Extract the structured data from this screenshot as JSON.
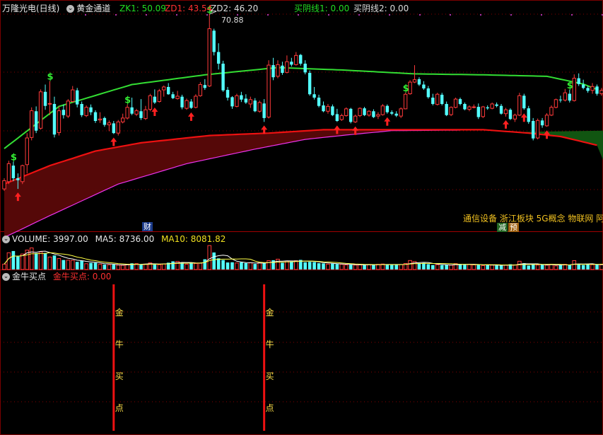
{
  "main": {
    "title": "万隆光电(日线)",
    "indicator_name": "黄金通道",
    "legend": [
      {
        "key": "zk1",
        "text": "ZK1: 50.09",
        "color": "#22dd22"
      },
      {
        "key": "zd1",
        "text": "ZD1: 43.54",
        "color": "#ff3030"
      },
      {
        "key": "zd2",
        "text": "ZD2: 46.20",
        "color": "#dddddd"
      },
      {
        "key": "syx1",
        "text": "买阴线1: 0.00",
        "color": "#22dd22"
      },
      {
        "key": "syx2",
        "text": "买阴线2: 0.00",
        "color": "#dddddd"
      }
    ],
    "high_label": "70.88",
    "finance_badge": "财",
    "concepts": "通信设备 浙江板块 5G概念 物联网 阿",
    "badge_reduce": "减",
    "badge_pre": "预",
    "dollar_marker": "$"
  },
  "volume": {
    "label": "VOLUME: 3997.00",
    "ma5": "MA5: 8736.00",
    "ma10": "MA10: 8081.82"
  },
  "signal": {
    "name": "金牛买点",
    "value_text": "金牛买点: 0.00",
    "vertical_chars": [
      "金",
      "牛",
      "买",
      "点"
    ]
  },
  "colors": {
    "up": "#ff3a3a",
    "down": "#54ffff",
    "upper_line": "#33dd33",
    "lower_line": "#ee1111",
    "pink_line": "#ee33ee",
    "channel_fill": "#5a0808",
    "channel_fill_green": "#115511",
    "grid_dot": "#880000",
    "ma5": "#ffffff",
    "ma10": "#ffff44"
  },
  "chart_data": {
    "type": "candlestick",
    "price_range": [
      28,
      72
    ],
    "candles": [
      [
        36,
        38.2,
        35.6,
        37.7
      ],
      [
        37.5,
        41.8,
        37,
        41.2
      ],
      [
        40.8,
        41.6,
        37.6,
        38.2
      ],
      [
        38.2,
        39.2,
        36,
        37.8
      ],
      [
        37.5,
        41,
        37,
        40.8
      ],
      [
        41,
        47.5,
        39.2,
        46.5
      ],
      [
        46.6,
        52.8,
        46,
        52.1
      ],
      [
        52,
        53,
        47.5,
        48
      ],
      [
        48.5,
        56.5,
        48.2,
        56
      ],
      [
        56,
        57.5,
        52.3,
        53.1
      ],
      [
        53.5,
        58.2,
        51.2,
        53.6
      ],
      [
        53.5,
        55,
        46.6,
        47.2
      ],
      [
        47.6,
        53,
        47,
        52.1
      ],
      [
        52.3,
        53.4,
        50.5,
        51.2
      ],
      [
        51,
        54.5,
        50.6,
        54.1
      ],
      [
        54,
        57.2,
        53.8,
        56.4
      ],
      [
        56.3,
        56.8,
        52.8,
        53.4
      ],
      [
        53.5,
        54,
        50.8,
        51.2
      ],
      [
        51.1,
        53.2,
        50.8,
        52.8
      ],
      [
        52.8,
        53.4,
        51.2,
        51.8
      ],
      [
        51.8,
        52.2,
        49.6,
        50
      ],
      [
        50.2,
        51.8,
        49.6,
        50.4
      ],
      [
        50.6,
        50.9,
        48.8,
        49.2
      ],
      [
        49.2,
        50.1,
        47.9,
        49.6
      ],
      [
        49.5,
        50,
        47.3,
        47.5
      ],
      [
        47.5,
        50.2,
        47,
        49.8
      ],
      [
        49.8,
        51.5,
        49.5,
        50.6
      ],
      [
        50.6,
        53.4,
        50.3,
        52.8
      ],
      [
        52.8,
        54.8,
        51.2,
        51.5
      ],
      [
        51.4,
        52.5,
        51,
        52.1
      ],
      [
        52,
        54.5,
        50.2,
        50.6
      ],
      [
        50.5,
        53.1,
        50.2,
        52.3
      ],
      [
        52.4,
        55.6,
        52,
        55.2
      ],
      [
        55,
        56.5,
        53.5,
        53.8
      ],
      [
        54,
        56.6,
        53.8,
        56.2
      ],
      [
        56.4,
        57.3,
        55,
        57
      ],
      [
        57,
        57.8,
        55.4,
        55.5
      ],
      [
        55.5,
        56,
        54.5,
        54.7
      ],
      [
        54.6,
        56.2,
        54.4,
        55.1
      ],
      [
        55,
        55.4,
        52.4,
        52.8
      ],
      [
        52.6,
        54.6,
        52.3,
        54.2
      ],
      [
        54,
        54.5,
        52.5,
        52.7
      ],
      [
        52.8,
        55.5,
        52.6,
        55.1
      ],
      [
        55.2,
        58,
        55,
        57.5
      ],
      [
        57.4,
        58.6,
        56.4,
        56.8
      ],
      [
        57.2,
        72,
        57,
        69
      ],
      [
        68.6,
        69,
        63.5,
        64.2
      ],
      [
        64.2,
        66,
        60.6,
        61.8
      ],
      [
        61.8,
        62.4,
        56,
        56.3
      ],
      [
        56.4,
        57,
        54.2,
        54.8
      ],
      [
        54.9,
        55.1,
        52.5,
        53
      ],
      [
        53,
        55.6,
        52.8,
        55.2
      ],
      [
        55.3,
        56,
        53.9,
        54.4
      ],
      [
        54.6,
        55.5,
        53.5,
        53.8
      ],
      [
        53.5,
        55,
        52.7,
        54.4
      ],
      [
        54.2,
        54.7,
        51.8,
        52
      ],
      [
        52,
        54.2,
        51.7,
        53.8
      ],
      [
        53.6,
        54.5,
        49.8,
        50.6
      ],
      [
        50.8,
        62.5,
        50.5,
        61.5
      ],
      [
        61.5,
        63,
        58.4,
        59
      ],
      [
        59.2,
        62.5,
        58.8,
        61.6
      ],
      [
        61.4,
        62.2,
        59.5,
        59.9
      ],
      [
        60,
        63.5,
        59.8,
        62.2
      ],
      [
        62.2,
        63,
        61.2,
        61.6
      ],
      [
        61.6,
        64.2,
        61.4,
        63.5
      ],
      [
        63.6,
        63.8,
        61.4,
        61.8
      ],
      [
        61.8,
        62.5,
        59.6,
        60
      ],
      [
        59.9,
        60.4,
        55.2,
        55.5
      ],
      [
        55.5,
        57,
        54.4,
        54.8
      ],
      [
        54.8,
        55.4,
        52.8,
        53.1
      ],
      [
        53.2,
        54,
        51.8,
        52
      ],
      [
        52,
        53.5,
        51.5,
        53
      ],
      [
        53,
        53.4,
        51,
        51.2
      ],
      [
        51.4,
        52.5,
        49.8,
        50
      ],
      [
        50.3,
        51.5,
        50,
        51.1
      ],
      [
        51.1,
        52.8,
        50.9,
        52.5
      ],
      [
        52.5,
        52.7,
        49.5,
        49.8
      ],
      [
        49.8,
        51.3,
        49.6,
        51
      ],
      [
        51.1,
        52.8,
        50.8,
        52.6
      ],
      [
        52.6,
        52.9,
        51,
        51.2
      ],
      [
        51.2,
        52.2,
        50.9,
        52
      ],
      [
        52,
        52.4,
        50.6,
        50.8
      ],
      [
        51,
        51.8,
        50.4,
        51.3
      ],
      [
        51.3,
        53.5,
        51.1,
        53.1
      ],
      [
        53.1,
        53.4,
        51.5,
        51.8
      ],
      [
        51.8,
        52.2,
        51.2,
        51.5
      ],
      [
        51.5,
        52,
        50.8,
        51.1
      ],
      [
        51,
        52.8,
        50.6,
        52.5
      ],
      [
        52.5,
        55.8,
        52.4,
        55.5
      ],
      [
        55.6,
        58.4,
        55.4,
        58
      ],
      [
        58,
        61.5,
        57.8,
        58.5
      ],
      [
        58.6,
        59,
        57.2,
        57.5
      ],
      [
        57.5,
        58.2,
        56.4,
        56.7
      ],
      [
        56.7,
        57.2,
        54.6,
        54.9
      ],
      [
        54.8,
        55.6,
        53.2,
        53.5
      ],
      [
        53.4,
        55.8,
        53.2,
        55.5
      ],
      [
        55.4,
        55.8,
        53.2,
        53.5
      ],
      [
        53.5,
        54,
        51,
        51.2
      ],
      [
        51.3,
        53,
        51,
        52.8
      ],
      [
        52.8,
        54.8,
        52.6,
        54.5
      ],
      [
        54.5,
        54.8,
        53.2,
        53.5
      ],
      [
        53.5,
        53.8,
        52.2,
        52.4
      ],
      [
        52.4,
        53.2,
        52,
        52.9
      ],
      [
        52.8,
        53.4,
        52.6,
        52.9
      ],
      [
        52.9,
        53.6,
        50.4,
        50.8
      ],
      [
        50.9,
        53.1,
        50.6,
        52.9
      ],
      [
        52.8,
        53.2,
        52.3,
        52.6
      ],
      [
        52.6,
        53.8,
        52.4,
        53.5
      ],
      [
        53.4,
        53.8,
        52.8,
        53.1
      ],
      [
        53.1,
        53.5,
        51.3,
        51.5
      ],
      [
        51.5,
        52.7,
        50.9,
        52.3
      ],
      [
        52.3,
        52.6,
        50.2,
        50.4
      ],
      [
        50.4,
        51.5,
        49.8,
        51.2
      ],
      [
        51.2,
        55.8,
        51,
        55.2
      ],
      [
        55.2,
        55.6,
        52.3,
        52.6
      ],
      [
        52.6,
        53.1,
        49.4,
        49.8
      ],
      [
        50,
        50.6,
        46,
        46.4
      ],
      [
        46.5,
        50.5,
        46.2,
        50.1
      ],
      [
        50.1,
        50.6,
        48.6,
        49.1
      ],
      [
        49,
        51.6,
        48.8,
        51.2
      ],
      [
        51.2,
        53.2,
        51,
        52.8
      ],
      [
        52.8,
        54.6,
        52.6,
        54.4
      ],
      [
        54.4,
        55.2,
        53.8,
        54.3
      ],
      [
        54.3,
        56.6,
        54,
        55.8
      ],
      [
        55.6,
        56.4,
        53.8,
        54.2
      ],
      [
        54.2,
        59.6,
        54,
        58.8
      ],
      [
        58.8,
        59.8,
        57.2,
        57.6
      ],
      [
        57.5,
        58.5,
        56.5,
        56.8
      ],
      [
        56.8,
        57.2,
        55.8,
        56.2
      ],
      [
        56.3,
        57.8,
        55.6,
        57.1
      ],
      [
        57.1,
        57.5,
        55.2,
        55.6
      ],
      [
        55.6,
        56.8,
        55.2,
        56.3
      ],
      [
        56.3,
        57,
        55,
        55.4
      ]
    ],
    "upper_line": [
      [
        0,
        44.3
      ],
      [
        12,
        53
      ],
      [
        28,
        57.5
      ],
      [
        44,
        59.5
      ],
      [
        60,
        61
      ],
      [
        74,
        60.5
      ],
      [
        90,
        59.7
      ],
      [
        105,
        59.5
      ],
      [
        119,
        59.2
      ],
      [
        127,
        57.6
      ],
      [
        130,
        56.5
      ]
    ],
    "lower_line": [
      [
        0,
        37
      ],
      [
        10,
        40.8
      ],
      [
        20,
        43.8
      ],
      [
        30,
        45.5
      ],
      [
        45,
        47
      ],
      [
        58,
        47.5
      ],
      [
        70,
        48.2
      ],
      [
        85,
        48.2
      ],
      [
        105,
        48.2
      ],
      [
        115,
        47.5
      ],
      [
        122,
        46.8
      ],
      [
        130,
        45
      ]
    ],
    "pink_line": [
      [
        0,
        26
      ],
      [
        10,
        30.5
      ],
      [
        25,
        37
      ],
      [
        40,
        41.2
      ],
      [
        55,
        44.2
      ],
      [
        66,
        46.2
      ],
      [
        75,
        47.1
      ],
      [
        85,
        48
      ],
      [
        100,
        48.1
      ]
    ],
    "buy_arrows": [
      3,
      24,
      33,
      41,
      57,
      73,
      77,
      84,
      110,
      114,
      119
    ],
    "dollar_markers": [
      2,
      10,
      27,
      45,
      88,
      124
    ],
    "volume": [
      5200,
      16200,
      17900,
      12600,
      15000,
      18800,
      20900,
      15900,
      17100,
      16000,
      12100,
      13600,
      10600,
      9200,
      9000,
      8800,
      7400,
      8600,
      5600,
      6400,
      6500,
      5100,
      4800,
      4500,
      4700,
      4300,
      4100,
      5000,
      6000,
      5700,
      4600,
      5200,
      6400,
      5500,
      4600,
      5400,
      6600,
      7900,
      7800,
      6700,
      5100,
      6600,
      5800,
      6300,
      9900,
      23200,
      16500,
      10800,
      9200,
      6800,
      7000,
      6300,
      6900,
      6200,
      6400,
      5400,
      6500,
      6500,
      8600,
      9000,
      10000,
      6500,
      8200,
      7800,
      8500,
      9300,
      7000,
      7400,
      7200,
      6100,
      5900,
      5200,
      5700,
      5300,
      5000,
      4400,
      4700,
      4300,
      4500,
      4700,
      4700,
      4500,
      5000,
      5300,
      5000,
      4400,
      4700,
      4800,
      5800,
      8700,
      7700,
      6100,
      6300,
      5200,
      4300,
      4600,
      4300,
      4600,
      4200,
      5700,
      5300,
      5000,
      5000,
      4500,
      4500,
      3800,
      4500,
      4300,
      4000,
      3900,
      4100,
      5100,
      4500,
      8000,
      6100,
      3800,
      5100,
      4300,
      4900,
      4200,
      5000,
      3500,
      4600,
      5000,
      4300,
      8600,
      4700,
      4300,
      5300,
      4700,
      5200,
      4600,
      5300
    ],
    "signal_bars": [
      24,
      57
    ]
  }
}
